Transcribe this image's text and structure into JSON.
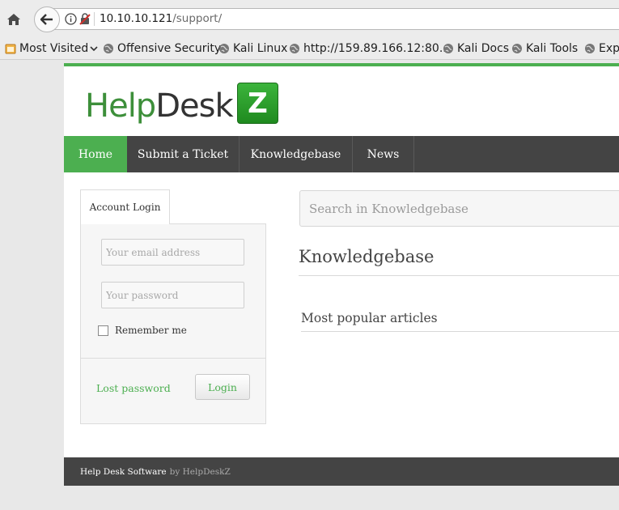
{
  "browser": {
    "url_host": "10.10.10.121",
    "url_path": "/support/",
    "bookmarks": [
      {
        "label": "Most Visited",
        "icon": "folder-icon"
      },
      {
        "label": "Offensive Security",
        "icon": "globe-icon"
      },
      {
        "label": "Kali Linux",
        "icon": "globe-icon"
      },
      {
        "label": "http://159.89.166.12:80...",
        "icon": "globe-icon"
      },
      {
        "label": "Kali Docs",
        "icon": "globe-icon"
      },
      {
        "label": "Kali Tools",
        "icon": "globe-icon"
      },
      {
        "label": "Expl",
        "icon": "globe-icon"
      }
    ]
  },
  "site": {
    "logo": {
      "help": "Help",
      "desk": "Desk",
      "z": "Z"
    },
    "nav": [
      "Home",
      "Submit a Ticket",
      "Knowledgebase",
      "News"
    ],
    "colors": {
      "accent": "#4caf50",
      "nav_bg": "#444444"
    }
  },
  "login": {
    "tab_label": "Account Login",
    "email_placeholder": "Your email address",
    "password_placeholder": "Your password",
    "remember_label": "Remember me",
    "lost_password": "Lost password",
    "login_button": "Login"
  },
  "knowledgebase": {
    "search_placeholder": "Search in Knowledgebase",
    "title": "Knowledgebase",
    "popular_title": "Most popular articles"
  },
  "footer": {
    "software": "Help Desk Software",
    "by": "by HelpDeskZ"
  }
}
